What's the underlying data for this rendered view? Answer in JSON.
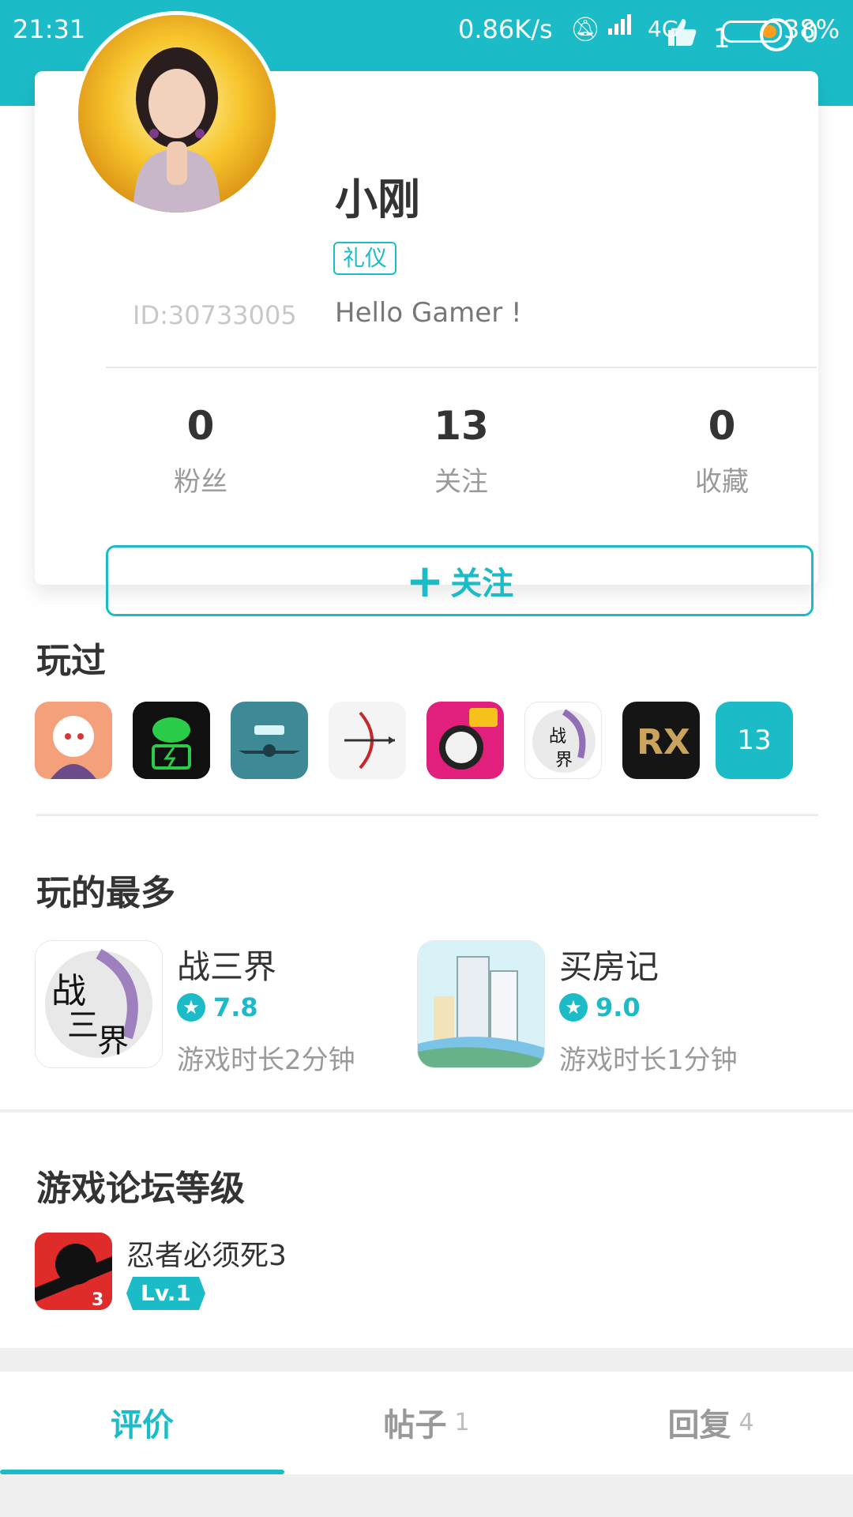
{
  "status_bar": {
    "time": "21:31",
    "speed": "0.86K/s",
    "network": "4G",
    "battery": "38%",
    "thumb_count": "1",
    "message_count": "0"
  },
  "profile": {
    "name": "小刚",
    "tag": "礼仪",
    "user_id": "ID:30733005",
    "bio": "Hello Gamer !",
    "stats": [
      {
        "value": "0",
        "label": "粉丝"
      },
      {
        "value": "13",
        "label": "关注"
      },
      {
        "value": "0",
        "label": "收藏"
      }
    ],
    "follow_button": {
      "icon": "plus-icon",
      "label": "关注"
    }
  },
  "played": {
    "title": "玩过",
    "icons": [
      "anime-girl-game-icon",
      "brain-battery-game-icon",
      "plane-game-icon",
      "archery-game-icon",
      "music-ball-game-icon",
      "zhansanjie-game-icon",
      "wangzhe-game-icon"
    ],
    "count": "13"
  },
  "most_played": {
    "title": "玩的最多",
    "items": [
      {
        "name": "战三界",
        "rating": "7.8",
        "time": "游戏时长2分钟"
      },
      {
        "name": "买房记",
        "rating": "9.0",
        "time": "游戏时长1分钟"
      }
    ]
  },
  "forum_level": {
    "title": "游戏论坛等级",
    "game": "忍者必须死3",
    "level": "Lv.1"
  },
  "tabs": [
    {
      "label": "评价",
      "count": ""
    },
    {
      "label": "帖子",
      "count": "1"
    },
    {
      "label": "回复",
      "count": "4"
    }
  ],
  "colors": {
    "accent": "#1bbcc8"
  }
}
